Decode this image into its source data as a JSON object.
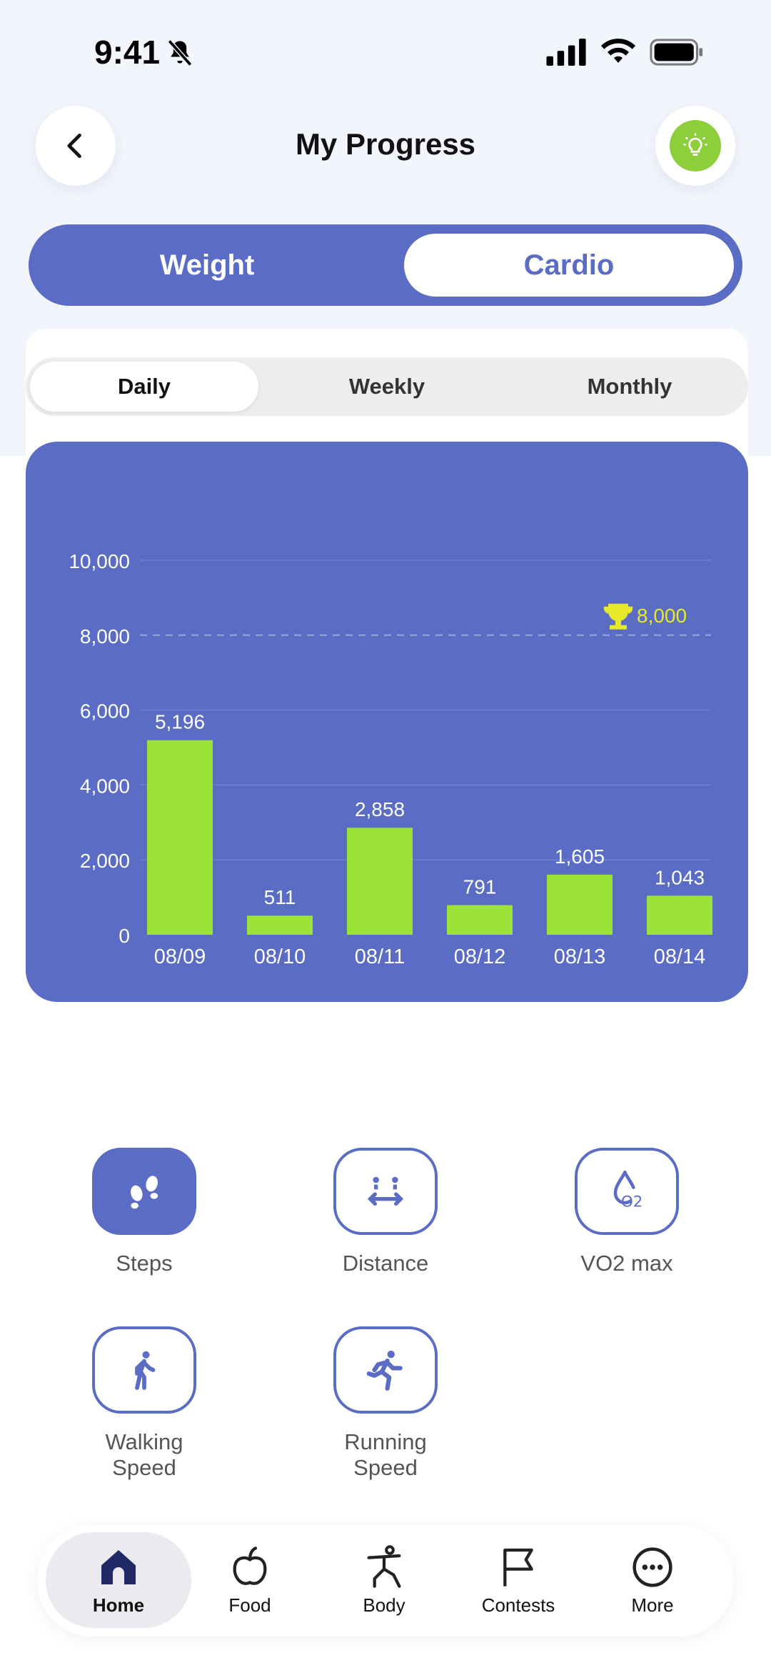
{
  "status_bar": {
    "time": "9:41"
  },
  "header": {
    "title": "My Progress"
  },
  "main_toggle": {
    "weight_label": "Weight",
    "cardio_label": "Cardio",
    "selected": "Cardio"
  },
  "period_tabs": [
    {
      "label": "Daily",
      "active": true
    },
    {
      "label": "Weekly",
      "active": false
    },
    {
      "label": "Monthly",
      "active": false
    }
  ],
  "colors": {
    "accent": "#5a6cc4",
    "bar": "#9be336",
    "goal": "#e8e82a",
    "tip": "#8ccf3a"
  },
  "chart_data": {
    "type": "bar",
    "categories": [
      "08/09",
      "08/10",
      "08/11",
      "08/12",
      "08/13",
      "08/14"
    ],
    "values": [
      5196,
      511,
      2858,
      791,
      1605,
      1043
    ],
    "value_labels": [
      "5,196",
      "511",
      "2,858",
      "791",
      "1,605",
      "1,043"
    ],
    "yticks": [
      "0",
      "2,000",
      "4,000",
      "6,000",
      "8,000",
      "10,000"
    ],
    "ytick_values": [
      0,
      2000,
      4000,
      6000,
      8000,
      10000
    ],
    "ylim": [
      0,
      10000
    ],
    "goal": {
      "value": 8000,
      "label": "8,000",
      "icon": "trophy-icon"
    },
    "grid": true
  },
  "metrics": [
    {
      "label": "Steps",
      "icon": "footprints-icon",
      "active": true
    },
    {
      "label": "Distance",
      "icon": "distance-icon",
      "active": false
    },
    {
      "label": "VO2 max",
      "icon": "vo2-icon",
      "active": false
    },
    {
      "label": "Walking\nSpeed",
      "icon": "walking-icon",
      "active": false
    },
    {
      "label": "Running\nSpeed",
      "icon": "running-icon",
      "active": false
    }
  ],
  "nav": [
    {
      "label": "Home",
      "icon": "home-icon",
      "active": true
    },
    {
      "label": "Food",
      "icon": "apple-icon",
      "active": false
    },
    {
      "label": "Body",
      "icon": "body-icon",
      "active": false
    },
    {
      "label": "Contests",
      "icon": "flag-icon",
      "active": false
    },
    {
      "label": "More",
      "icon": "more-icon",
      "active": false
    }
  ]
}
